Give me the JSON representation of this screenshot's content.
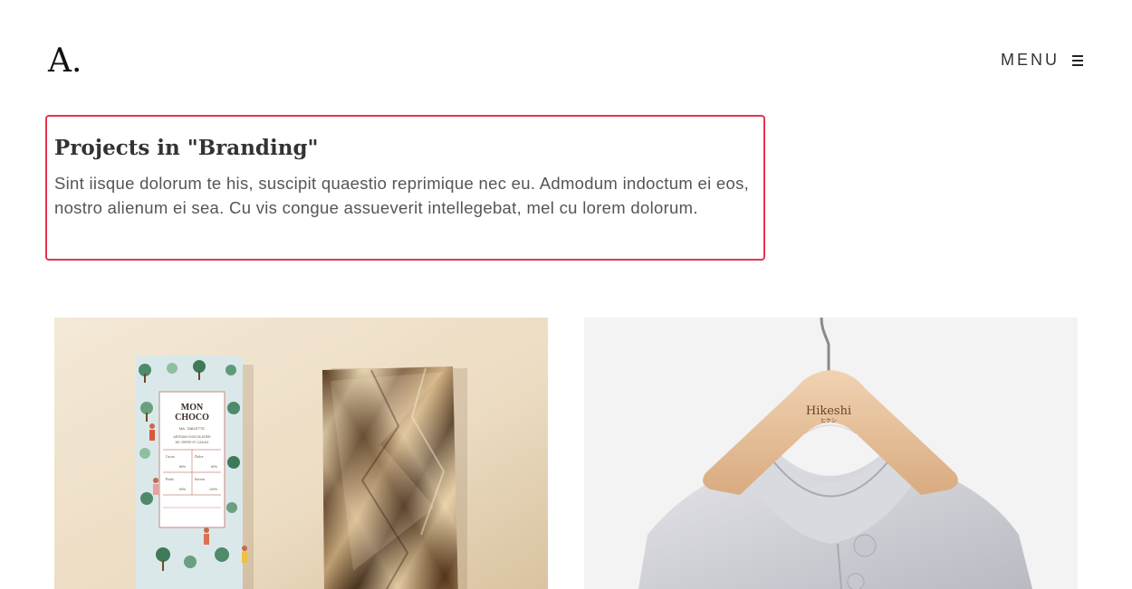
{
  "header": {
    "logo": "A.",
    "menu_label": "MENU"
  },
  "intro": {
    "title": "Projects in \"Branding\"",
    "description": "Sint iisque dolorum te his, suscipit quaestio reprimique nec eu. Admodum indoctum ei eos, nostro alienum ei sea. Cu vis congue assueverit intellegebat, mel cu lorem dolorum."
  },
  "projects": [
    {
      "image": "mon-choco-chocolate-packaging",
      "package_text": [
        "MON",
        "CHOCO",
        "MA. TABLETTE",
        "ARTISAN CHOCOLATIER",
        "DE CREPE ET CACAO"
      ],
      "table_labels": [
        "Cacao",
        "Dulce",
        "Poids",
        "Saveur"
      ],
      "table_values": [
        "80%",
        "60%",
        "90%",
        "100%"
      ]
    },
    {
      "image": "hikeshi-hanger-jacket",
      "brand": "Hikeshi",
      "brand_sub": "ヒケシ"
    }
  ],
  "colors": {
    "highlight_border": "#e8344e",
    "choco_bg": "#efe3cf",
    "jacket_bg": "#f3f3f3"
  }
}
